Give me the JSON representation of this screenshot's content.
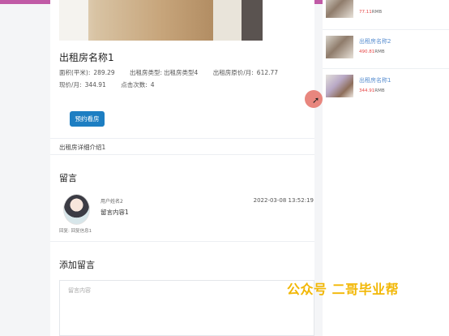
{
  "listing": {
    "title": "出租房名称1",
    "area_label": "面积(平米):",
    "area_value": "289.29",
    "type_label": "出租房类型:",
    "type_value": "出租房类型4",
    "price_label": "出租房原价/月:",
    "price_value": "612.77",
    "discount_label": "现价/月:",
    "discount_value": "344.91",
    "clicks_label": "点击次数:",
    "clicks_value": "4",
    "book_button": "预约看房",
    "description": "出租房详细介绍1"
  },
  "comments": {
    "heading": "留言",
    "items": [
      {
        "user": "用户姓名2",
        "content": "留言内容1",
        "date": "2022-03-08 13:52:19",
        "reply": "回复: 回复信息1"
      }
    ]
  },
  "add_comment": {
    "heading": "添加留言",
    "placeholder": "留言内容"
  },
  "sidebar": {
    "items": [
      {
        "name": "",
        "price": "77.11",
        "unit": "RMB"
      },
      {
        "name": "出租房名称2",
        "price": "490.81",
        "unit": "RMB"
      },
      {
        "name": "出租房名称1",
        "price": "344.91",
        "unit": "RMB"
      }
    ]
  },
  "watermark": "公众号 二哥毕业帮",
  "colors": {
    "primary_button": "#1d7ec2",
    "sidebar_name": "#5a8fd0",
    "sidebar_price": "#e64646",
    "watermark": "#f2b705",
    "top_strip": "#c05aa6"
  },
  "icons": {
    "cursor": "mouse-pointer-icon"
  }
}
